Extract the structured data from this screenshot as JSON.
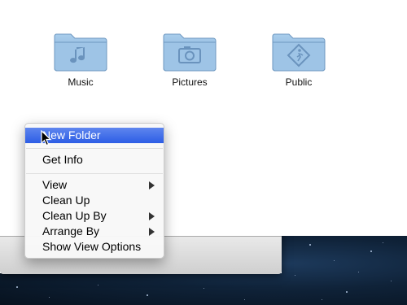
{
  "folders": [
    {
      "label": "Music",
      "icon": "music-folder-icon"
    },
    {
      "label": "Pictures",
      "icon": "pictures-folder-icon"
    },
    {
      "label": "Public",
      "icon": "public-folder-icon"
    }
  ],
  "context_menu": {
    "items": [
      {
        "label": "New Folder",
        "highlighted": true,
        "submenu": false
      },
      {
        "label": "Get Info",
        "submenu": false
      },
      {
        "label": "View",
        "submenu": true
      },
      {
        "label": "Clean Up",
        "submenu": false
      },
      {
        "label": "Clean Up By",
        "submenu": true
      },
      {
        "label": "Arrange By",
        "submenu": true
      },
      {
        "label": "Show View Options",
        "submenu": false
      }
    ]
  },
  "colors": {
    "folder_blue": "#8fb6d9",
    "menu_highlight": "#3a6be8",
    "desktop": "#0b1a2c"
  }
}
